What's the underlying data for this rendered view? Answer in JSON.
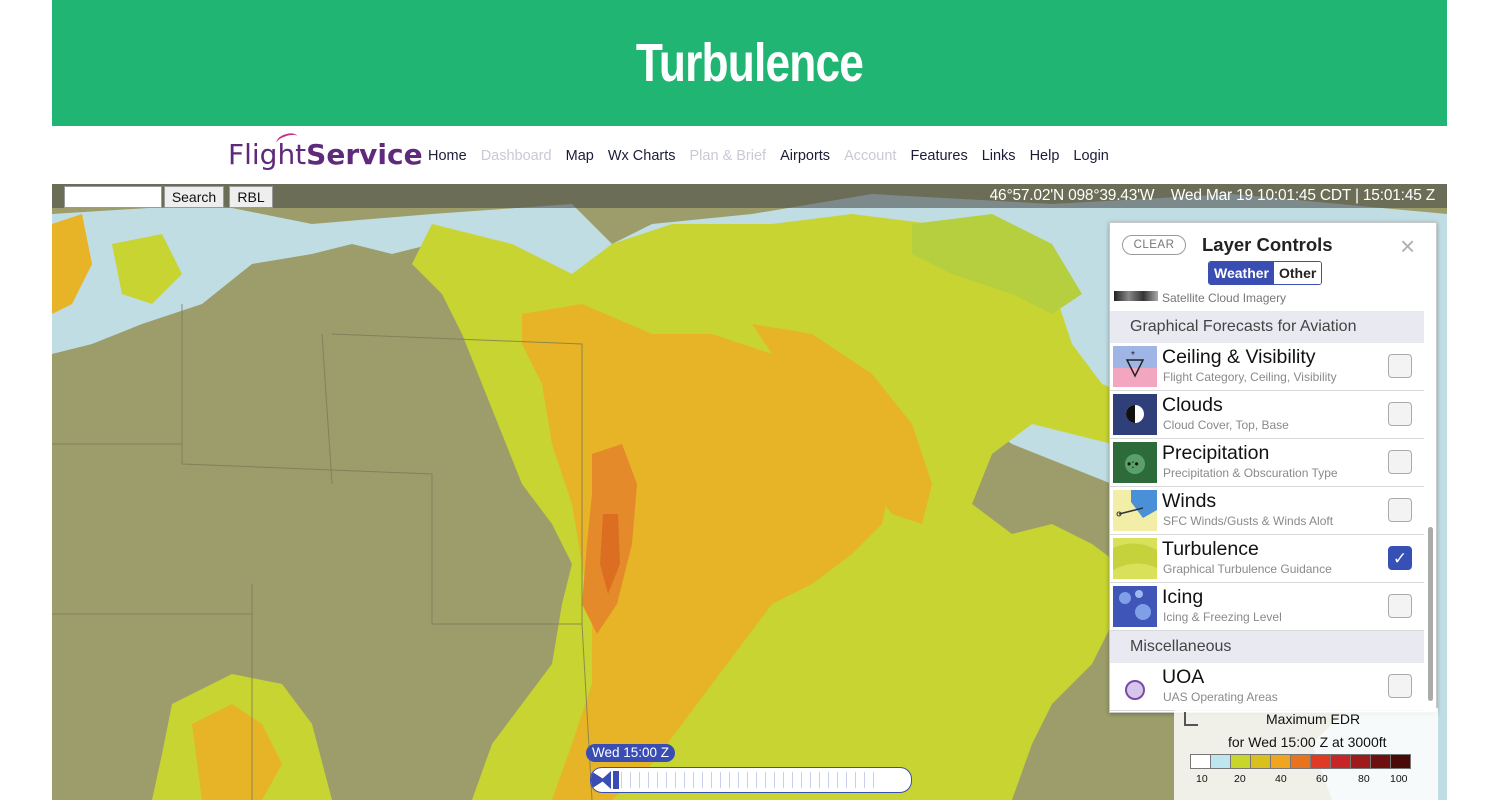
{
  "banner": {
    "title": "Turbulence"
  },
  "brand": {
    "name_light": "Flight",
    "name_bold": "Service"
  },
  "nav": [
    {
      "label": "Home",
      "enabled": true
    },
    {
      "label": "Dashboard",
      "enabled": false
    },
    {
      "label": "Map",
      "enabled": true
    },
    {
      "label": "Wx Charts",
      "enabled": true
    },
    {
      "label": "Plan & Brief",
      "enabled": false
    },
    {
      "label": "Airports",
      "enabled": true
    },
    {
      "label": "Account",
      "enabled": false
    },
    {
      "label": "Features",
      "enabled": true
    },
    {
      "label": "Links",
      "enabled": true
    },
    {
      "label": "Help",
      "enabled": true
    },
    {
      "label": "Login",
      "enabled": true
    }
  ],
  "map_toolbar": {
    "search_value": "",
    "search_button": "Search",
    "rbl_button": "RBL",
    "coords": "46°57.02'N 098°39.43'W",
    "local_time": "Wed Mar 19 10:01:45 CDT | 15:01:45 Z"
  },
  "layer_panel": {
    "clear_label": "CLEAR",
    "title": "Layer Controls",
    "close_icon": "×",
    "tabs": {
      "weather": "Weather",
      "other": "Other",
      "active": "Weather"
    },
    "partial_row": "Satellite Cloud Imagery",
    "section_gfa": "Graphical Forecasts for Aviation",
    "layers": [
      {
        "title": "Ceiling & Visibility",
        "subtitle": "Flight Category, Ceiling, Visibility",
        "checked": false,
        "icon": "ceiling-visibility-icon"
      },
      {
        "title": "Clouds",
        "subtitle": "Cloud Cover, Top, Base",
        "checked": false,
        "icon": "clouds-icon"
      },
      {
        "title": "Precipitation",
        "subtitle": "Precipitation & Obscuration Type",
        "checked": false,
        "icon": "precipitation-icon"
      },
      {
        "title": "Winds",
        "subtitle": "SFC Winds/Gusts & Winds Aloft",
        "checked": false,
        "icon": "winds-icon"
      },
      {
        "title": "Turbulence",
        "subtitle": "Graphical Turbulence Guidance",
        "checked": true,
        "icon": "turbulence-icon"
      },
      {
        "title": "Icing",
        "subtitle": "Icing & Freezing Level",
        "checked": false,
        "icon": "icing-icon"
      }
    ],
    "section_misc": "Miscellaneous",
    "misc_layers": [
      {
        "title": "UOA",
        "subtitle": "UAS Operating Areas",
        "checked": false,
        "icon": "uoa-circle-icon"
      }
    ],
    "check_mark": "✓"
  },
  "legend": {
    "title": "Maximum EDR",
    "subtitle": "for Wed 15:00 Z at 3000ft",
    "colors": [
      "#ffffff",
      "#bfe6ef",
      "#c8d52a",
      "#d9c01e",
      "#efa51f",
      "#e8731f",
      "#e03a25",
      "#c62726",
      "#9e1a1c",
      "#6e1010",
      "#4a0a08"
    ],
    "tick_labels": [
      "10",
      "20",
      "40",
      "60",
      "80",
      "100"
    ]
  },
  "timeline": {
    "current_label": "Wed 15:00 Z"
  }
}
